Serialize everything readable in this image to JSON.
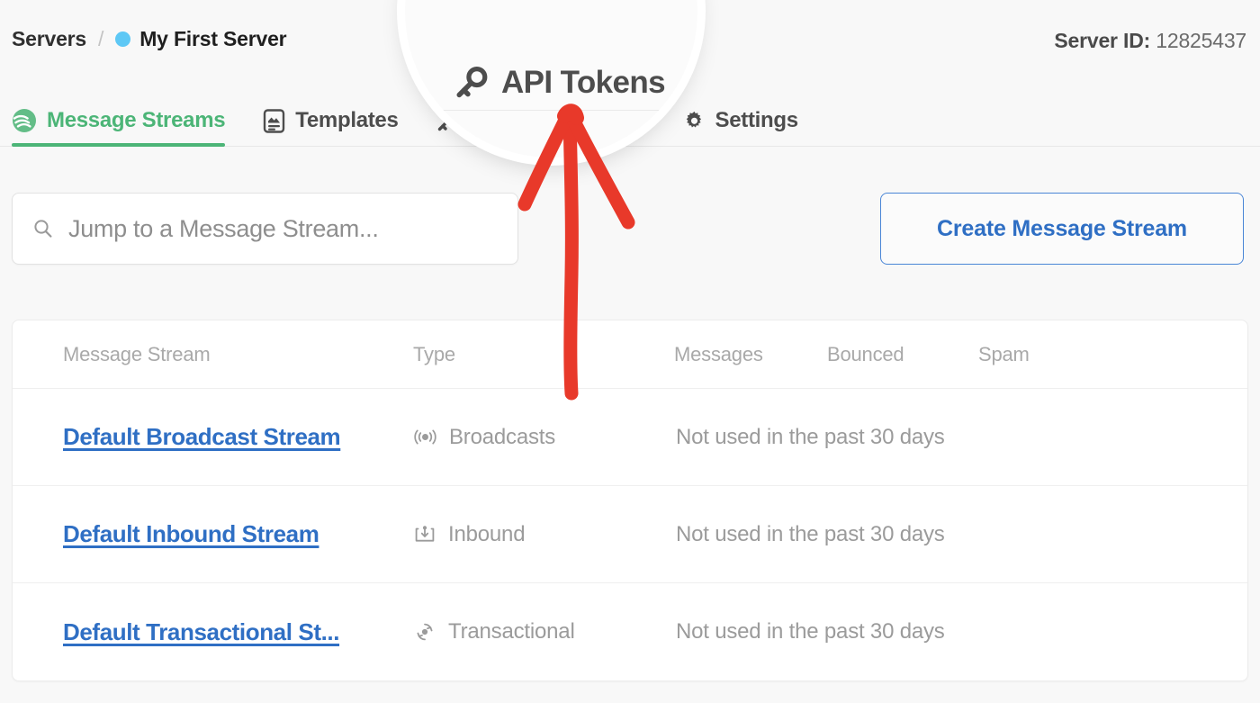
{
  "header": {
    "breadcrumb": {
      "root": "Servers",
      "separator": "/",
      "current": "My First Server",
      "dot_color": "#5ec8f5"
    },
    "server_id_label": "Server ID:",
    "server_id_value": "12825437"
  },
  "tabs": [
    {
      "label": "Message Streams",
      "icon": "streams-icon",
      "active": true
    },
    {
      "label": "Templates",
      "icon": "templates-icon",
      "active": false
    },
    {
      "label": "API Tokens",
      "icon": "key-icon",
      "active": false
    },
    {
      "label": "Settings",
      "icon": "gear-icon",
      "active": false
    }
  ],
  "toolbar": {
    "search_placeholder": "Jump to a Message Stream...",
    "search_value": "",
    "search_icon": "search-icon",
    "create_label": "Create Message Stream"
  },
  "table": {
    "columns": [
      "Message Stream",
      "Type",
      "Messages",
      "Bounced",
      "Spam"
    ],
    "rows": [
      {
        "name": "Default Broadcast Stream",
        "type": "Broadcasts",
        "type_icon": "broadcast-icon",
        "usage": "Not used in the past 30 days"
      },
      {
        "name": "Default Inbound Stream",
        "type": "Inbound",
        "type_icon": "inbound-icon",
        "usage": "Not used in the past 30 days"
      },
      {
        "name": "Default Transactional St...",
        "type": "Transactional",
        "type_icon": "transactional-icon",
        "usage": "Not used in the past 30 days"
      }
    ]
  },
  "magnifier": {
    "highlighted_tab": "API Tokens",
    "icon": "key-icon"
  },
  "annotation": {
    "type": "arrow-up",
    "color": "#e8392a",
    "points_to": "API Tokens"
  },
  "colors": {
    "accent_green": "#4cb577",
    "link_blue": "#2f6fc4",
    "annotation_red": "#e8392a",
    "page_bg": "#f8f8f8"
  }
}
